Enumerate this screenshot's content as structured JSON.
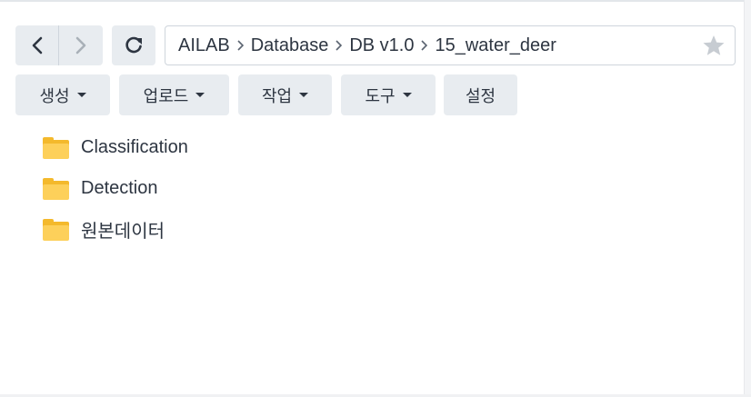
{
  "navigation": {
    "back_icon": "chevron-left-icon",
    "forward_icon": "chevron-right-icon",
    "refresh_icon": "refresh-icon"
  },
  "path": {
    "crumbs": [
      "AILAB",
      "Database",
      "DB v1.0",
      "15_water_deer"
    ],
    "favorite_icon": "star-icon"
  },
  "toolbar": {
    "create_label": "생성",
    "upload_label": "업로드",
    "action_label": "작업",
    "tools_label": "도구",
    "settings_label": "설정"
  },
  "files": [
    {
      "name": "Classification",
      "type": "folder"
    },
    {
      "name": "Detection",
      "type": "folder"
    },
    {
      "name": "원본데이터",
      "type": "folder"
    }
  ],
  "colors": {
    "button_bg": "#e8ecf0",
    "folder": "#fdd05a",
    "text": "#2d3541"
  }
}
